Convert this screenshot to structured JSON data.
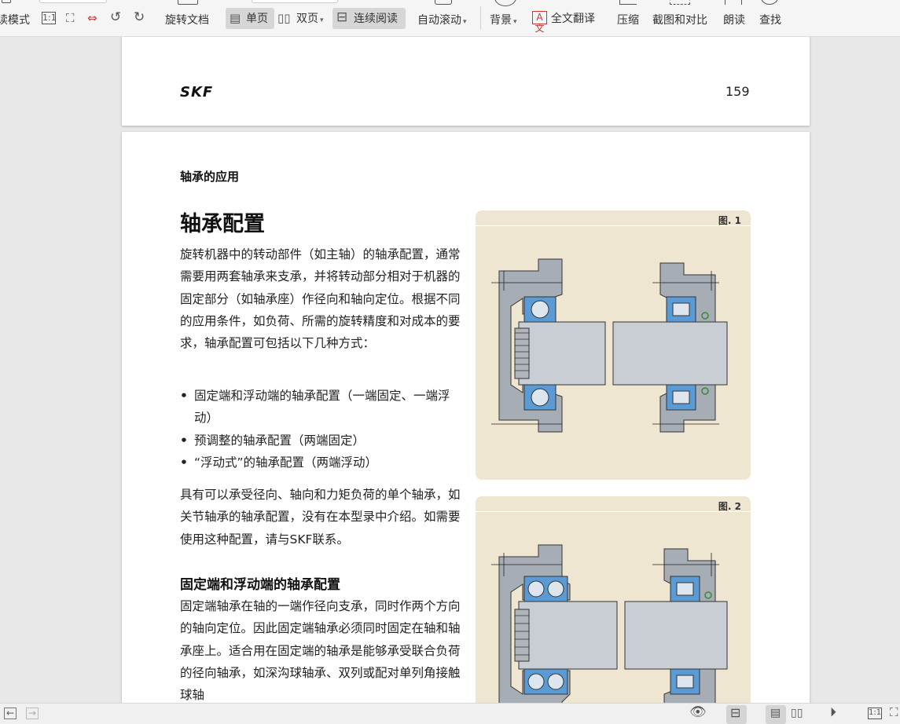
{
  "toolbar": {
    "mode_label": "读模式",
    "rotate_doc": "旋转文档",
    "single_page": "单页",
    "double_page": "双页",
    "continuous": "连续阅读",
    "auto_scroll": "自动滚动",
    "background": "背景",
    "translate": "全文翻译",
    "compress": "压缩",
    "screenshot_compare": "截图和对比",
    "read_aloud": "朗读",
    "find": "查找"
  },
  "page_top": {
    "logo": "SKF",
    "page_number": "159"
  },
  "page": {
    "section_label": "轴承的应用",
    "title": "轴承配置",
    "intro": "旋转机器中的转动部件（如主轴）的轴承配置，通常需要用两套轴承来支承，并将转动部分相对于机器的固定部分（如轴承座）作径向和轴向定位。根据不同的应用条件，如负荷、所需的旋转精度和对成本的要求，轴承配置可包括以下几种方式：",
    "bullets": [
      "固定端和浮动端的轴承配置（一端固定、一端浮动）",
      "预调整的轴承配置（两端固定）",
      "“浮动式”的轴承配置（两端浮动）"
    ],
    "para2": "具有可以承受径向、轴向和力矩负荷的单个轴承，如关节轴承的轴承配置，没有在本型录中介绍。如需要使用这种配置，请与SKF联系。",
    "subheading": "固定端和浮动端的轴承配置",
    "para3": "固定端轴承在轴的一端作径向支承，同时作两个方向的轴向定位。因此固定端轴承必须同时固定在轴和轴承座上。适合用在固定端的轴承是能够承受联合负荷的径向轴承，如深沟球轴承、双列或配对单列角接触球轴",
    "fig1_label": "图. 1",
    "fig2_label": "图. 2"
  },
  "colors": {
    "figure_bg": "#efe6d2",
    "bearing_blue": "#5b9bd5",
    "housing_gray": "#a7adb5",
    "shaft_gray": "#c9ced4"
  }
}
